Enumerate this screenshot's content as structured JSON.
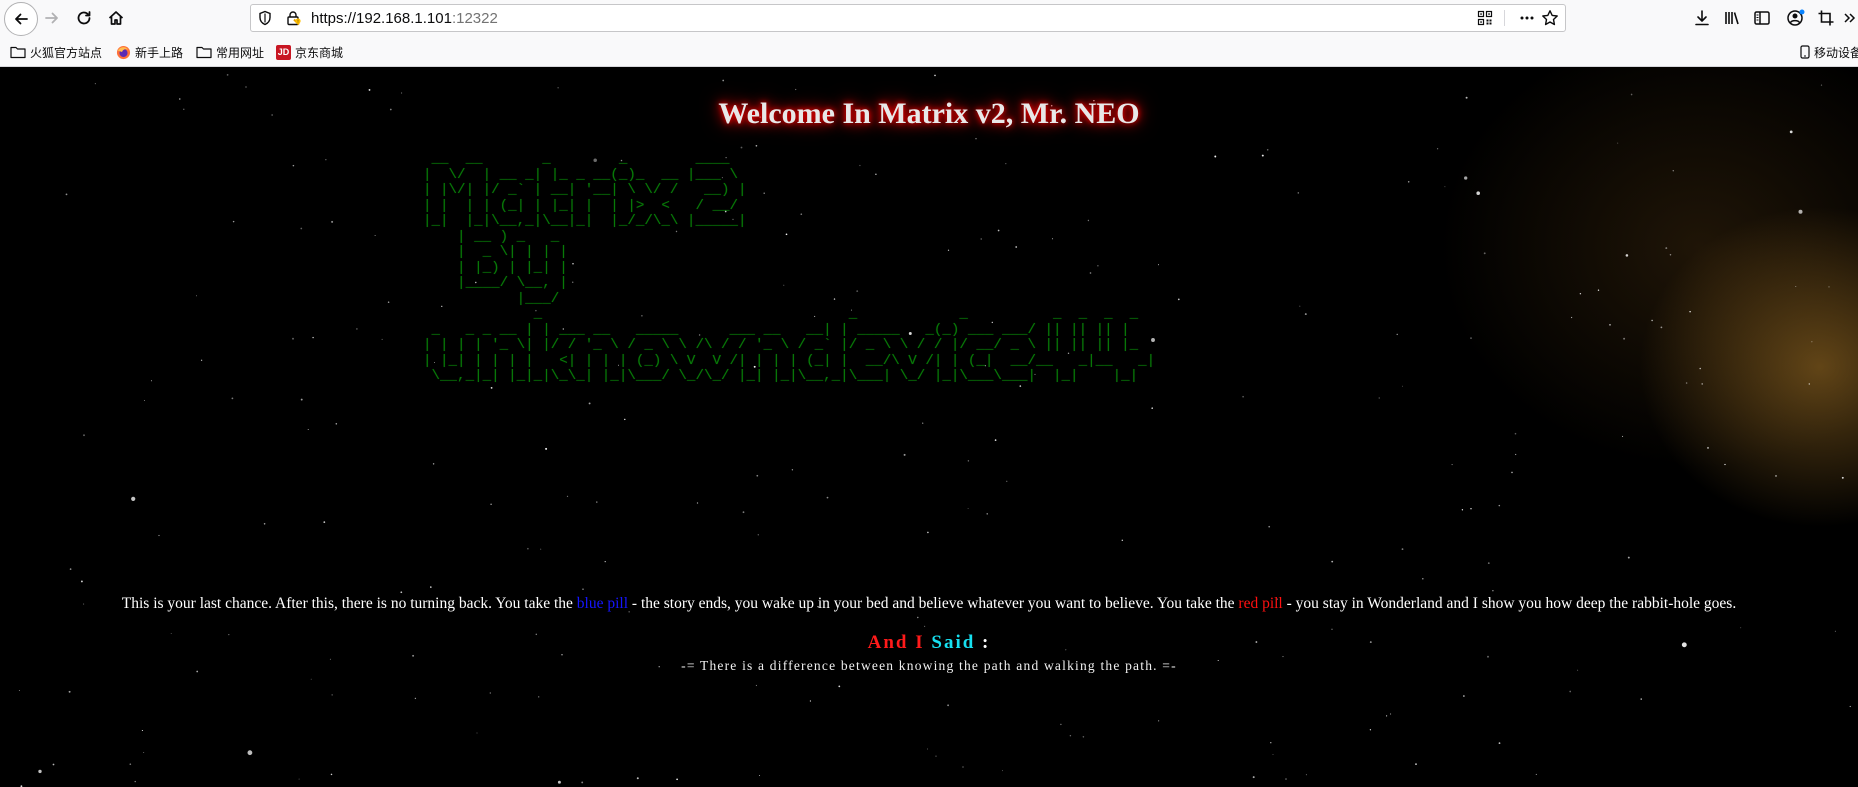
{
  "browser": {
    "url_host": "https://192.168.1.101",
    "url_port": ":12322",
    "bookmarks": [
      {
        "label": "火狐官方站点",
        "icon": "folder-icon"
      },
      {
        "label": "新手上路",
        "icon": "firefox-icon"
      },
      {
        "label": "常用网址",
        "icon": "folder-icon"
      },
      {
        "label": "京东商城",
        "icon": "jd-icon",
        "logo_text": "JD"
      }
    ],
    "mobile_bookmarks": "移动设备"
  },
  "page": {
    "title": "Welcome In Matrix v2, Mr. NEO",
    "ascii_art": " __  __       _        _        ____\n|  \\/  | __ _| |_ _ __(_)_  __ |___ \\\n| |\\/| |/ _` | __| '__| \\ \\/ /   __) |\n| |  | | (_| | |_| |  | |>  <   / __/\n|_|  |_|\\__,_|\\__|_|  |_/_/\\_\\ |_____|\n    | __ ) _   _\n    |  _ \\| | | |\n    | |_) | |_| |\n    |____/ \\__, |\n           |___/\n             _                                    _            _          _  _  _  _\n _   _ _ __ | | ___ __   _____      ___ __   __| | _____   _(_) ___ ___/ || || || |\n| | | | '_ \\| |/ / '_ \\ / _ \\ \\ /\\ / / '_ \\ / _` |/ _ \\ \\ / / |/ __/ _ \\ || || || |_\n| |_| | | | |   <| | | | (_) \\ V  V /| | | | (_| |  __/\\ V /| | (_|  __/__   _|__   _|\n \\__,_|_| |_|_|\\_\\_| |_|\\___/ \\_/\\_/ |_| |_|\\__,_|\\___| \\_/ |_|\\___\\___|  |_|    |_|",
    "quote": {
      "before": "This is your last chance. After this, there is no turning back. You take the ",
      "blue": "blue pill",
      "middle": " - the story ends, you wake up in your bed and believe whatever you want to believe. You take the ",
      "red": "red pill",
      "after": " - you stay in Wonderland and I show you how deep the rabbit-hole goes."
    },
    "said": {
      "part1": "And I ",
      "part2": "Said",
      "part3": " :"
    },
    "motto": "-= There is a difference between knowing the path and walking the path. =-"
  },
  "colors": {
    "ascii": "#0a8f0a",
    "blue_pill": "#1515ff",
    "red_pill": "#ff1010",
    "said_cyan": "#16e0f0"
  }
}
